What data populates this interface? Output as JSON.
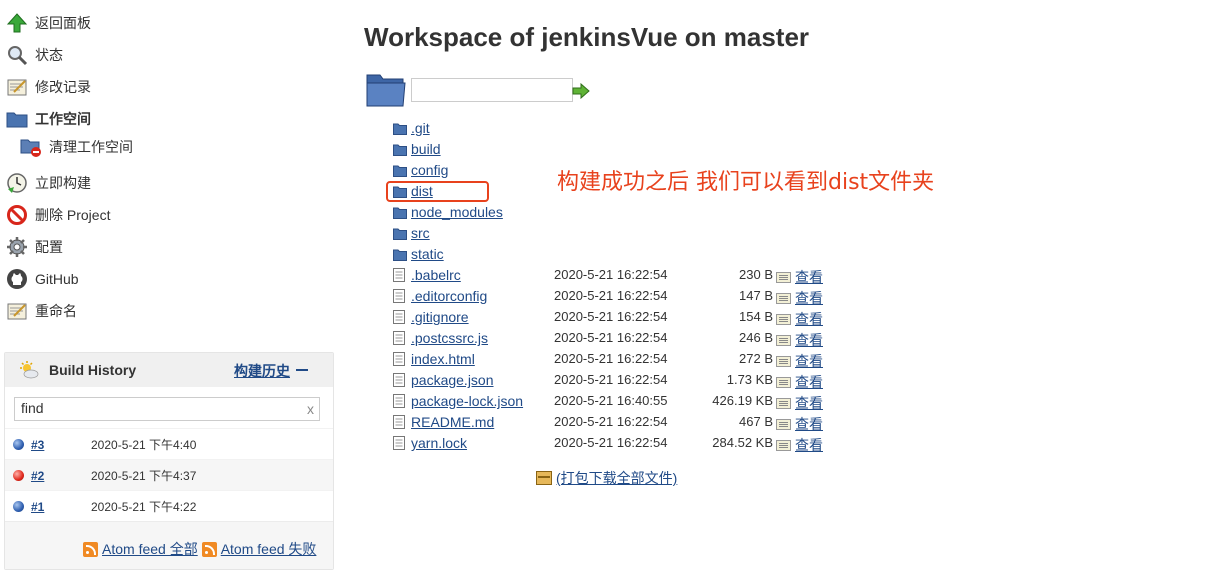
{
  "sidebar": {
    "items": [
      {
        "label": "返回面板",
        "icon": "up-arrow-icon"
      },
      {
        "label": "状态",
        "icon": "magnifier-icon"
      },
      {
        "label": "修改记录",
        "icon": "notepad-icon"
      },
      {
        "label": "工作空间",
        "icon": "folder-icon"
      },
      {
        "label": "清理工作空间",
        "icon": "folder-delete-icon"
      },
      {
        "label": "立即构建",
        "icon": "clock-icon"
      },
      {
        "label": "删除 Project",
        "icon": "no-entry-icon"
      },
      {
        "label": "配置",
        "icon": "gear-icon"
      },
      {
        "label": "GitHub",
        "icon": "github-icon"
      },
      {
        "label": "重命名",
        "icon": "notepad-icon"
      }
    ]
  },
  "build_history": {
    "title": "Build History",
    "trend_label": "构建历史",
    "search_value": "find",
    "clear_glyph": "x",
    "builds": [
      {
        "number": "#3",
        "time": "2020-5-21 下午4:40",
        "status": "blue"
      },
      {
        "number": "#2",
        "time": "2020-5-21 下午4:37",
        "status": "red"
      },
      {
        "number": "#1",
        "time": "2020-5-21 下午4:22",
        "status": "blue"
      }
    ],
    "feed_all": "Atom feed 全部",
    "feed_failed": "Atom feed 失败"
  },
  "main": {
    "title": "Workspace of jenkinsVue on master",
    "path_value": "",
    "folders": [
      ".git",
      "build",
      "config",
      "dist",
      "node_modules",
      "src",
      "static"
    ],
    "files": [
      {
        "name": ".babelrc",
        "date": "2020-5-21 16:22:54",
        "size": "230 B"
      },
      {
        "name": ".editorconfig",
        "date": "2020-5-21 16:22:54",
        "size": "147 B"
      },
      {
        "name": ".gitignore",
        "date": "2020-5-21 16:22:54",
        "size": "154 B"
      },
      {
        "name": ".postcssrc.js",
        "date": "2020-5-21 16:22:54",
        "size": "246 B"
      },
      {
        "name": "index.html",
        "date": "2020-5-21 16:22:54",
        "size": "272 B"
      },
      {
        "name": "package.json",
        "date": "2020-5-21 16:22:54",
        "size": "1.73 KB"
      },
      {
        "name": "package-lock.json",
        "date": "2020-5-21 16:40:55",
        "size": "426.19 KB"
      },
      {
        "name": "README.md",
        "date": "2020-5-21 16:22:54",
        "size": "467 B"
      },
      {
        "name": "yarn.lock",
        "date": "2020-5-21 16:22:54",
        "size": "284.52 KB"
      }
    ],
    "view_label": "查看",
    "zip_label": "(打包下载全部文件)",
    "annotation": "构建成功之后 我们可以看到dist文件夹"
  },
  "colors": {
    "link": "#204a87",
    "annotation": "#e8421d",
    "folder": "#4a74b0"
  }
}
